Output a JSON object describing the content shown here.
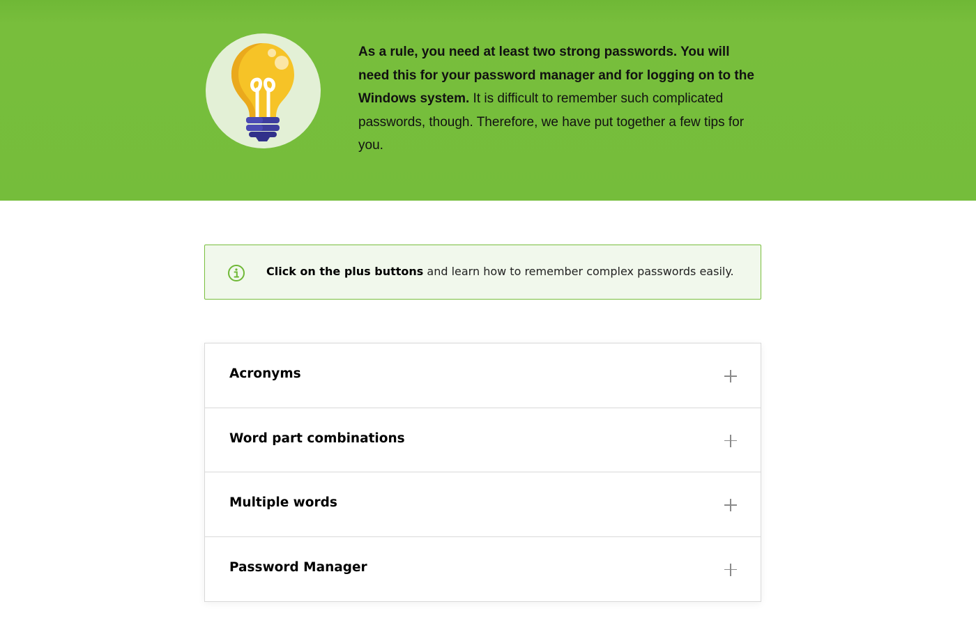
{
  "hero": {
    "icon": "lightbulb-icon",
    "text_bold": "As a rule, you need at least two strong passwords. You will need this for your password manager and for logging on to the Windows system.",
    "text_regular": " It is difficult to remember such complicated passwords, though. Therefore, we have put together a few tips for you.",
    "background_color": "#75bd3b"
  },
  "info_box": {
    "icon": "info-circle-icon",
    "text_bold": "Click on the plus buttons",
    "text_regular": " and learn how to remember complex passwords easily.",
    "border_color": "#78be3c",
    "background_color": "#f1f8ec"
  },
  "accordion": {
    "items": [
      {
        "title": "Acronyms",
        "icon": "plus-icon"
      },
      {
        "title": "Word part combinations",
        "icon": "plus-icon"
      },
      {
        "title": "Multiple words",
        "icon": "plus-icon"
      },
      {
        "title": "Password Manager",
        "icon": "plus-icon"
      }
    ]
  }
}
